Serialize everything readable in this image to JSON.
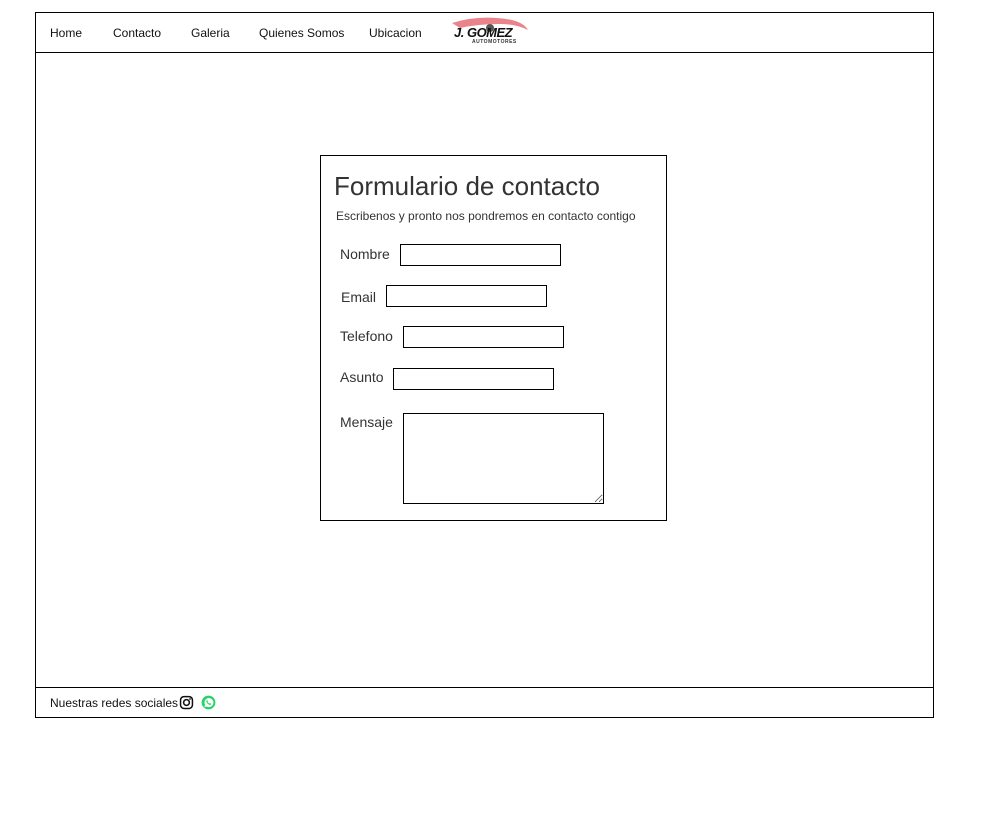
{
  "nav": {
    "items": [
      {
        "label": "Home"
      },
      {
        "label": "Contacto"
      },
      {
        "label": "Galeria"
      },
      {
        "label": "Quienes Somos"
      },
      {
        "label": "Ubicacion"
      }
    ],
    "logo": {
      "text": "J. GOMEZ",
      "sub": "AUTOMOTORES",
      "swoosh_color": "#e8848a"
    }
  },
  "form": {
    "title": "Formulario de contacto",
    "subtitle": "Escribenos y pronto nos pondremos en contacto contigo",
    "fields": [
      {
        "label": "Nombre",
        "value": ""
      },
      {
        "label": "Email",
        "value": ""
      },
      {
        "label": "Telefono",
        "value": ""
      },
      {
        "label": "Asunto",
        "value": ""
      }
    ],
    "message": {
      "label": "Mensaje",
      "value": ""
    }
  },
  "footer": {
    "text": "Nuestras redes sociales",
    "icons": [
      "instagram-icon",
      "whatsapp-icon"
    ],
    "whatsapp_color": "#25d366"
  }
}
